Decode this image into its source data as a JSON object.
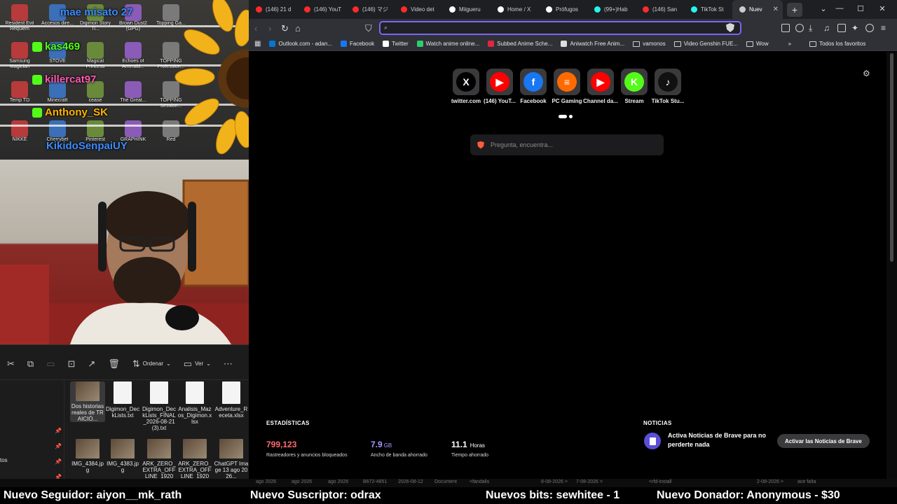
{
  "overlay": {
    "desktop_row1": [
      "Resident Evil Requiem",
      "Accesos dire...",
      "Digimon Story Ti...",
      "Brown Dust2 (GPG)",
      "Topping Ga..."
    ],
    "desktop_row2": [
      "Samsung Magician",
      "STOVE",
      "Magical Princess",
      "Echoes of Amerald...",
      "TOPPING Profession..."
    ],
    "desktop_row3": [
      "Temp TD",
      "Minecraft",
      "cease",
      "The Great...",
      "TOPPING Session..."
    ],
    "desktop_row4": [
      "NIKKE",
      "Cherrybet",
      "Pinterest",
      "GRAPHINK",
      "Red"
    ],
    "chat": [
      {
        "name": "mae misato 27",
        "color": "#3c8cff"
      },
      {
        "name": "kas469",
        "color": "#53fc18"
      },
      {
        "name": "killercat97",
        "color": "#ff5ab0"
      },
      {
        "name": "Anthony_SK",
        "color": "#ffb400"
      },
      {
        "name": "KikidoSenpaiUY",
        "color": "#3c8cff"
      }
    ]
  },
  "explorer": {
    "toolbar": {
      "sort_label": "Ordenar",
      "view_label": "Ver"
    },
    "files": [
      {
        "name": "Dos historias reales de TRAICIÓ..."
      },
      {
        "name": "Digimon_DeckLists.txt"
      },
      {
        "name": "Digimon_DeckLists_FINAL_2026-08-21(3).txt"
      },
      {
        "name": "Analisis_Mazos_Digimon.xlsx"
      },
      {
        "name": "Adventure_Receta.xlsx"
      },
      {
        "name": "IMG_4384.jpg"
      },
      {
        "name": "IMG_4383.jpg"
      },
      {
        "name": "ARK_ZERO_EXTRA_OFFLINE_1920x..."
      },
      {
        "name": "ARK_ZERO_EXTRA_OFFLINE_1920x..."
      },
      {
        "name": "ChatGPT Image 13 ago 2026..."
      }
    ],
    "nav_label": "tos"
  },
  "browser": {
    "tabs": [
      {
        "label": "(146) 21 d",
        "color": "#ff2a2a"
      },
      {
        "label": "(146) YouT",
        "color": "#ff2a2a"
      },
      {
        "label": "(146) マジ",
        "color": "#ff2a2a"
      },
      {
        "label": "Video det",
        "color": "#ff2a2a"
      },
      {
        "label": "Miigueru",
        "color": "#ffffff"
      },
      {
        "label": "Home / X",
        "color": "#ffffff"
      },
      {
        "label": "Prófugos",
        "color": "#ffffff"
      },
      {
        "label": "(99+)Hab",
        "color": "#25f4ee"
      },
      {
        "label": "(146) San",
        "color": "#ff2a2a"
      },
      {
        "label": "TikTok St",
        "color": "#25f4ee"
      },
      {
        "label": "Nuev",
        "color": "#cccccc"
      }
    ],
    "address_value": "",
    "bookmarks": [
      {
        "label": "Outlook.com - adan...",
        "color": "#0078d4",
        "kind": "fav"
      },
      {
        "label": "Facebook",
        "color": "#1877f2",
        "kind": "fav"
      },
      {
        "label": "Twitter",
        "color": "#ffffff",
        "kind": "fav"
      },
      {
        "label": "Watch anime online...",
        "color": "#2ecc71",
        "kind": "fav"
      },
      {
        "label": "Subbed Anime Sche...",
        "color": "#e0283c",
        "kind": "fav"
      },
      {
        "label": "Aniwatch Free Anim...",
        "color": "#dddddd",
        "kind": "fav"
      },
      {
        "label": "vamonos",
        "color": "#cfcfcf",
        "kind": "folder"
      },
      {
        "label": "Video Genshin FUE...",
        "color": "#cfcfcf",
        "kind": "folder"
      },
      {
        "label": "Wow",
        "color": "#cfcfcf",
        "kind": "folder"
      }
    ],
    "bookmarks_overflow": "»",
    "all_favorites": "Todos los favoritos",
    "top_sites": [
      {
        "label": "twitter.com",
        "glyph": "X",
        "bg": "#000000"
      },
      {
        "label": "(146) YouT...",
        "glyph": "▶",
        "bg": "#ff0000"
      },
      {
        "label": "Facebook",
        "glyph": "f",
        "bg": "#1877f2"
      },
      {
        "label": "PC Gaming",
        "glyph": "≡",
        "bg": "#ff6a00"
      },
      {
        "label": "Channel da...",
        "glyph": "▶",
        "bg": "#ff0000"
      },
      {
        "label": "Stream",
        "glyph": "K",
        "bg": "#53fc18"
      },
      {
        "label": "TikTok Stu...",
        "glyph": "♪",
        "bg": "#111111"
      }
    ],
    "search_placeholder": "Pregunta, encuentra...",
    "stats": {
      "title": "ESTADÍSTICAS",
      "trackers_value": "799,123",
      "trackers_desc": "Rastreadores y anuncios bloqueados",
      "bandwidth_value": "7.9",
      "bandwidth_unit": "GB",
      "bandwidth_desc": "Ancho de banda ahorrado",
      "time_value": "11.1",
      "time_unit": "Horas",
      "time_desc": "Tiempo ahorrado"
    },
    "news": {
      "title": "NOTICIAS",
      "text": "Activa Noticias de Brave para no perderte nada",
      "button": "Activar las Noticias de Brave"
    }
  },
  "ticker": {
    "follower": "Nuevo Seguidor: aiyon__mk_rath",
    "subscriber": "Nuevo Suscriptor: odrax",
    "bits": "Nuevos bits: sewhitee - 1",
    "donor": "Nuevo Donador: Anonymous - $30"
  },
  "strip_text": [
    "ago 2026",
    "ago 2026",
    "ago 2026",
    "B672-4851",
    "2026-08-12",
    "Document",
    "<fandalis",
    "8-08-2026 >",
    "7-08-2026 >",
    "<rfd-install",
    "2-08-2026 >",
    "ace falta"
  ]
}
